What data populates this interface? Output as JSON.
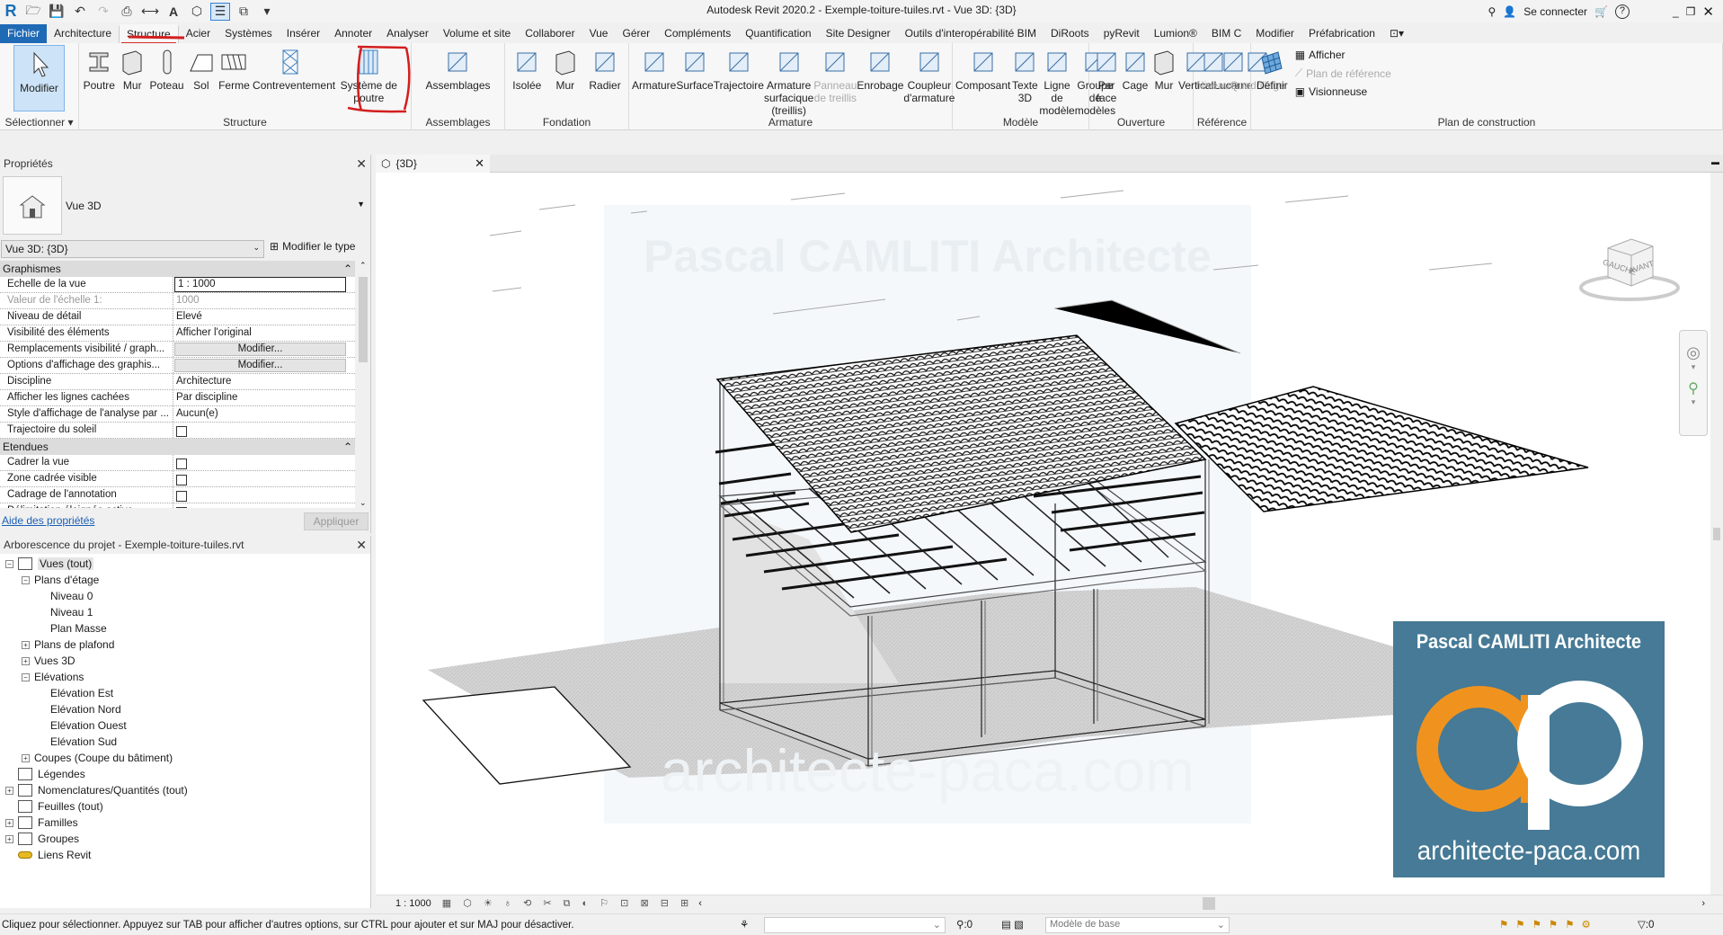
{
  "title_bar": {
    "app_title": "Autodesk Revit 2020.2 - Exemple-toiture-tuiles.rvt - Vue 3D: {3D}",
    "sign_in": "Se connecter",
    "help": "?"
  },
  "tabs": [
    "Fichier",
    "Architecture",
    "Structure",
    "Acier",
    "Systèmes",
    "Insérer",
    "Annoter",
    "Analyser",
    "Volume et site",
    "Collaborer",
    "Vue",
    "Gérer",
    "Compléments",
    "Quantification",
    "Site Designer",
    "Outils d'interopérabilité BIM",
    "DiRoots",
    "pyRevit",
    "Lumion®",
    "BIM C",
    "Modifier",
    "Préfabrication"
  ],
  "active_tab": "Structure",
  "ribbon": {
    "select": {
      "label": "Sélectionner",
      "buttons": [
        "Modifier"
      ]
    },
    "structure": {
      "label": "Structure",
      "buttons": [
        "Poutre",
        "Mur",
        "Poteau",
        "Sol",
        "Ferme",
        "Contreventement",
        "Système de poutre"
      ]
    },
    "assemblies": {
      "label": "Assemblages",
      "buttons": [
        "Assemblages"
      ]
    },
    "foundation": {
      "label": "Fondation",
      "buttons": [
        "Isolée",
        "Mur",
        "Radier"
      ]
    },
    "rebar": {
      "label": "Armature",
      "buttons": [
        "Armature",
        "Surface",
        "Trajectoire",
        "Armature surfacique (treillis)",
        "Panneau de treillis",
        "Enrobage",
        "Coupleur d'armature"
      ]
    },
    "model": {
      "label": "Modèle",
      "buttons": [
        "Composant",
        "Texte 3D",
        "Ligne de modèle",
        "Groupe de modèles"
      ]
    },
    "opening": {
      "label": "Ouverture",
      "buttons": [
        "Par face",
        "Cage",
        "Mur",
        "Vertical",
        "Lucarne"
      ]
    },
    "datum": {
      "label": "Référence",
      "buttons": [
        "Niveau",
        "Quadrillage"
      ]
    },
    "workplane": {
      "label": "Plan de construction",
      "buttons": [
        "Définir"
      ],
      "small": [
        "Afficher",
        "Plan de référence",
        "Visionneuse"
      ]
    }
  },
  "properties": {
    "title": "Propriétés",
    "type_name": "Vue 3D",
    "view_selector": "Vue 3D: {3D}",
    "edit_type": "Modifier le type",
    "groups": [
      {
        "name": "Graphismes",
        "rows": [
          {
            "key": "Echelle de la vue",
            "value": "1 : 1000"
          },
          {
            "key": "Valeur de l'échelle    1:",
            "value": "1000"
          },
          {
            "key": "Niveau de détail",
            "value": "Elevé"
          },
          {
            "key": "Visibilité des éléments",
            "value": "Afficher l'original"
          },
          {
            "key": "Remplacements visibilité / graph...",
            "value": "Modifier..."
          },
          {
            "key": "Options d'affichage des graphis...",
            "value": "Modifier..."
          },
          {
            "key": "Discipline",
            "value": "Architecture"
          },
          {
            "key": "Afficher les lignes cachées",
            "value": "Par discipline"
          },
          {
            "key": "Style d'affichage de l'analyse par ...",
            "value": "Aucun(e)"
          },
          {
            "key": "Trajectoire du soleil",
            "value": ""
          }
        ]
      },
      {
        "name": "Etendues",
        "rows": [
          {
            "key": "Cadrer la vue",
            "value": ""
          },
          {
            "key": "Zone cadrée visible",
            "value": ""
          },
          {
            "key": "Cadrage de l'annotation",
            "value": ""
          },
          {
            "key": "Délimitation éloignée active",
            "value": ""
          }
        ]
      }
    ],
    "help_link": "Aide des propriétés",
    "apply": "Appliquer"
  },
  "browser": {
    "title": "Arborescence du projet - Exemple-toiture-tuiles.rvt",
    "items": [
      {
        "label": "Vues (tout)",
        "level": 0,
        "exp": "-"
      },
      {
        "label": "Plans d'étage",
        "level": 1,
        "exp": "-"
      },
      {
        "label": "Niveau 0",
        "level": 2
      },
      {
        "label": "Niveau 1",
        "level": 2
      },
      {
        "label": "Plan Masse",
        "level": 2
      },
      {
        "label": "Plans de plafond",
        "level": 1,
        "exp": "+"
      },
      {
        "label": "Vues 3D",
        "level": 1,
        "exp": "+"
      },
      {
        "label": "Elévations",
        "level": 1,
        "exp": "-"
      },
      {
        "label": "Elévation Est",
        "level": 2
      },
      {
        "label": "Elévation Nord",
        "level": 2
      },
      {
        "label": "Elévation Ouest",
        "level": 2
      },
      {
        "label": "Elévation Sud",
        "level": 2
      },
      {
        "label": "Coupes (Coupe du bâtiment)",
        "level": 1,
        "exp": "+"
      },
      {
        "label": "Légendes",
        "level": 0
      },
      {
        "label": "Nomenclatures/Quantités (tout)",
        "level": 0,
        "exp": "+"
      },
      {
        "label": "Feuilles (tout)",
        "level": 0
      },
      {
        "label": "Familles",
        "level": 0,
        "exp": "+"
      },
      {
        "label": "Groupes",
        "level": 0,
        "exp": "+"
      },
      {
        "label": "Liens Revit",
        "level": 0
      }
    ]
  },
  "view": {
    "tab": "{3D}",
    "viewcube": {
      "left": "GAUCHE",
      "front": "AVANT"
    },
    "watermark": {
      "top": "Pascal CAMLITI Architecte",
      "bottom": "architecte-paca.com"
    },
    "logo": {
      "title": "Pascal CAMLITI Architecte",
      "letters": "ap",
      "url": "architecte-paca.com",
      "bg": "#467a96",
      "accent": "#f0931e"
    },
    "scale": "1 : 1000"
  },
  "status": {
    "message": "Cliquez pour sélectionner. Appuyez sur TAB pour afficher d'autres options, sur CTRL pour ajouter et sur MAJ pour désactiver.",
    "count": ":0",
    "model": "Modèle de base",
    "filter_count": ":0"
  }
}
